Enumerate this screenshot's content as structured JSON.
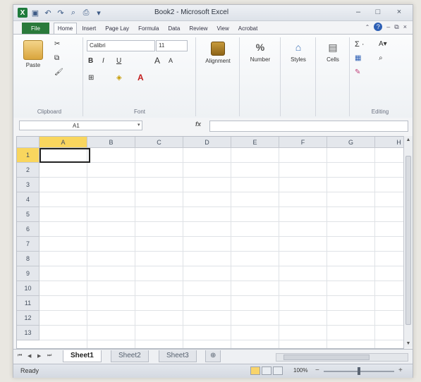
{
  "window": {
    "title": "Book2 - Microsoft Excel",
    "qat": [
      "excel-logo",
      "save",
      "undo",
      "redo",
      "print-preview",
      "print"
    ],
    "controls": [
      "–",
      "□",
      "×"
    ]
  },
  "tabs": [
    "File",
    "Home",
    "Insert",
    "Page Lay",
    "Formula",
    "Data",
    "Review",
    "View",
    "Acrobat"
  ],
  "active_tab": "Home",
  "ribbon": {
    "clipboard": {
      "label": "Clipboard",
      "paste": "Paste"
    },
    "font": {
      "label": "Font",
      "family": "Calibri",
      "size": "11",
      "bold": "B",
      "italic": "I",
      "underline": "U",
      "grow": "A",
      "shrink": "A"
    },
    "alignment": {
      "label": "Alignment"
    },
    "number": {
      "label": "Number",
      "icon_text": "%"
    },
    "styles": {
      "label": "Styles"
    },
    "cells": {
      "label": "Cells"
    },
    "editing": {
      "label": "Editing",
      "sum": "Σ ·",
      "sort": "A▾"
    }
  },
  "formula_bar": {
    "name_box": "A1",
    "fx": "fx"
  },
  "grid": {
    "columns": [
      "A",
      "B",
      "C",
      "D",
      "E",
      "F",
      "G",
      "H"
    ],
    "rows": [
      "1",
      "2",
      "3",
      "4",
      "5",
      "6",
      "7",
      "8",
      "9",
      "10",
      "11",
      "12",
      "13"
    ],
    "selected_col": "A",
    "selected_row": "1"
  },
  "sheets": [
    "Sheet1",
    "Sheet2",
    "Sheet3"
  ],
  "active_sheet": "Sheet1",
  "status": {
    "mode": "Ready",
    "zoom": "100%",
    "zoom_minus": "−",
    "zoom_plus": "+"
  }
}
